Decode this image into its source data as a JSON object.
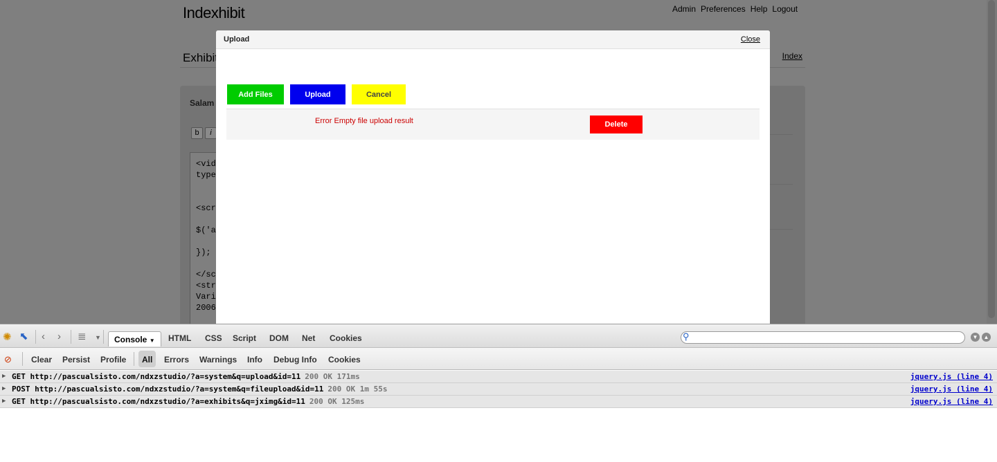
{
  "site": {
    "title": "Indexhibit",
    "nav": [
      "Admin",
      "Preferences",
      "Help",
      "Logout"
    ],
    "exhibit_label": "Exhibit",
    "index_link": "Index",
    "editor_heading": "Salam",
    "format_buttons": [
      "b",
      "i"
    ],
    "editor_lines": [
      "<vide",
      "type=",
      "",
      "",
      "<scri",
      "",
      "$('au",
      "",
      "});",
      "",
      "</scr",
      "<stro",
      "Varia",
      "2006"
    ]
  },
  "modal": {
    "title": "Upload",
    "close_label": "Close",
    "buttons": {
      "add_files": "Add Files",
      "upload": "Upload",
      "cancel": "Cancel"
    },
    "file_row": {
      "error": "Error Empty file upload result",
      "delete_label": "Delete"
    }
  },
  "firebug": {
    "tabs": [
      "Console",
      "HTML",
      "CSS",
      "Script",
      "DOM",
      "Net",
      "Cookies"
    ],
    "active_tab": "Console",
    "search": {
      "value": "",
      "placeholder": ""
    },
    "console_buttons": [
      "Clear",
      "Persist",
      "Profile"
    ],
    "filters": [
      "All",
      "Errors",
      "Warnings",
      "Info",
      "Debug Info",
      "Cookies"
    ],
    "active_filter": "All",
    "log": [
      {
        "method": "GET",
        "url": "http://pascualsisto.com/ndxzstudio/?a=system&q=upload&id=11",
        "status": "200 OK 171ms",
        "source": "jquery.js (line 4)"
      },
      {
        "method": "POST",
        "url": "http://pascualsisto.com/ndxzstudio/?a=system&q=fileupload&id=11",
        "status": "200 OK 1m 55s",
        "source": "jquery.js (line 4)"
      },
      {
        "method": "GET",
        "url": "http://pascualsisto.com/ndxzstudio/?a=exhibits&q=jximg&id=11",
        "status": "200 OK 125ms",
        "source": "jquery.js (line 4)"
      }
    ]
  },
  "icons": {
    "firebug": "firebug-bug-icon",
    "inspect": "inspect-cursor-icon",
    "back": "chevron-left-icon",
    "forward": "chevron-right-icon",
    "list": "list-icon",
    "search": "search-icon",
    "minimize": "minimize-icon",
    "detach": "detach-icon",
    "clear_errors": "error-filter-icon"
  },
  "colors": {
    "add_files": "#00cc00",
    "upload": "#0000ee",
    "cancel": "#ffff00",
    "delete": "#ff0000",
    "error_text": "#cc0000",
    "log_source": "#0000cc"
  }
}
